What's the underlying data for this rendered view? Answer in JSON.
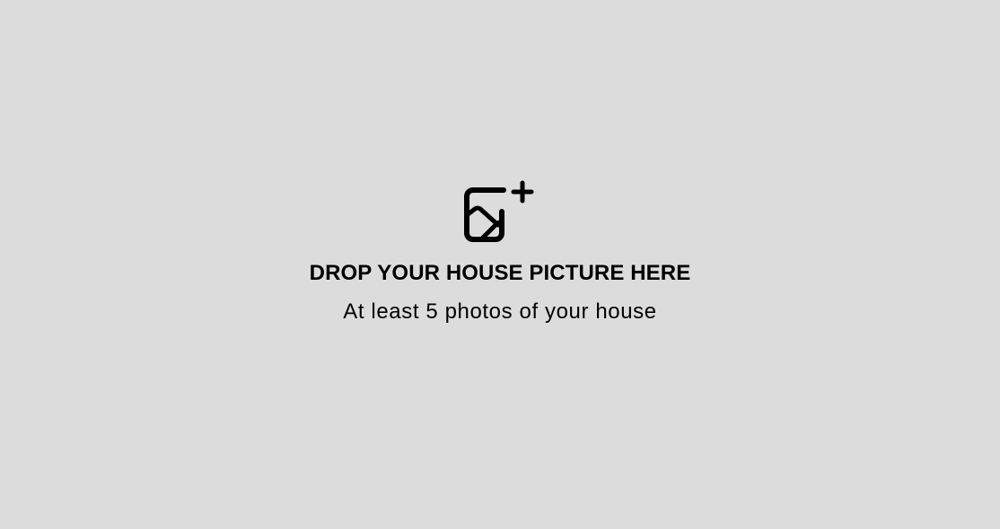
{
  "dropzone": {
    "icon": "add-image-icon",
    "title": "DROP YOUR HOUSE PICTURE HERE",
    "subtitle": "At least 5 photos of your house"
  },
  "colors": {
    "background": "#dcdcdc",
    "text": "#000000",
    "icon": "#000000"
  }
}
